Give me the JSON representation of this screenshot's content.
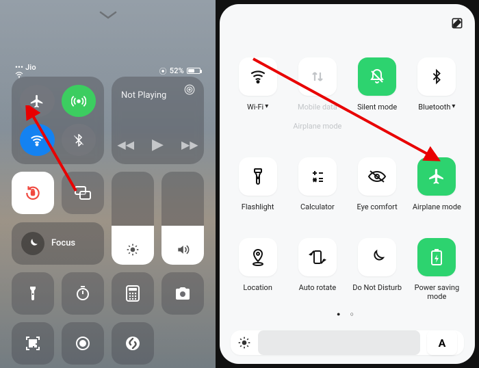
{
  "ios": {
    "carrier": "Jio",
    "battery_pct": "52%",
    "media_title": "Not Playing",
    "focus_label": "Focus",
    "tiles": {
      "airplane": "airplane-icon",
      "antenna": "cellular-antenna-icon",
      "wifi": "wifi-icon",
      "bluetooth": "bluetooth-icon",
      "lock": "rotation-lock-icon",
      "mirror": "screen-mirroring-icon",
      "flashlight": "flashlight-icon",
      "timer": "timer-icon",
      "calculator": "calculator-icon",
      "camera": "camera-icon",
      "qr": "qr-scan-icon",
      "record": "screen-record-icon",
      "shazam": "shazam-icon"
    }
  },
  "android": {
    "tiles": [
      {
        "key": "wifi",
        "label": "Wi-Fi",
        "sublabel": "",
        "on": false,
        "faded": false,
        "dropdown": true
      },
      {
        "key": "mobiledata",
        "label": "Mobile data",
        "sublabel": "Airplane mode",
        "on": false,
        "faded": true,
        "dropdown": false
      },
      {
        "key": "silent",
        "label": "Silent mode",
        "sublabel": "",
        "on": true,
        "faded": false,
        "dropdown": false
      },
      {
        "key": "bluetooth",
        "label": "Bluetooth",
        "sublabel": "",
        "on": false,
        "faded": false,
        "dropdown": true
      },
      {
        "key": "flashlight",
        "label": "Flashlight",
        "sublabel": "",
        "on": false,
        "faded": false,
        "dropdown": false
      },
      {
        "key": "calculator",
        "label": "Calculator",
        "sublabel": "",
        "on": false,
        "faded": false,
        "dropdown": false
      },
      {
        "key": "eyecomfort",
        "label": "Eye comfort",
        "sublabel": "",
        "on": false,
        "faded": false,
        "dropdown": false
      },
      {
        "key": "airplane",
        "label": "Airplane mode",
        "sublabel": "",
        "on": true,
        "faded": false,
        "dropdown": false
      },
      {
        "key": "location",
        "label": "Location",
        "sublabel": "",
        "on": false,
        "faded": false,
        "dropdown": false
      },
      {
        "key": "autorotate",
        "label": "Auto rotate",
        "sublabel": "",
        "on": false,
        "faded": false,
        "dropdown": false
      },
      {
        "key": "dnd",
        "label": "Do Not Disturb",
        "sublabel": "",
        "on": false,
        "faded": false,
        "dropdown": false
      },
      {
        "key": "powersave",
        "label": "Power saving mode",
        "sublabel": "",
        "on": true,
        "faded": false,
        "dropdown": false
      }
    ],
    "auto_brightness_label": "A",
    "page_dots": "●   ○"
  }
}
